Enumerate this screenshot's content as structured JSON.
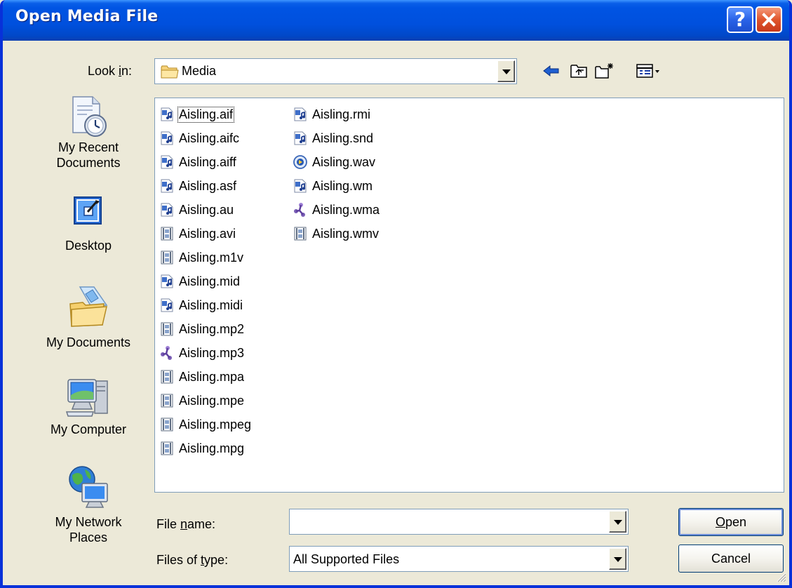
{
  "window": {
    "title": "Open Media File"
  },
  "look_in": {
    "label_pre": "Look ",
    "label_key": "i",
    "label_post": "n:",
    "value": "Media"
  },
  "places": [
    {
      "line1": "My Recent",
      "line2": "Documents",
      "icon": "recent-documents-icon"
    },
    {
      "line1": "Desktop",
      "line2": "",
      "icon": "desktop-icon"
    },
    {
      "line1": "My Documents",
      "line2": "",
      "icon": "my-documents-icon"
    },
    {
      "line1": "My Computer",
      "line2": "",
      "icon": "my-computer-icon"
    },
    {
      "line1": "My Network",
      "line2": "Places",
      "icon": "network-places-icon"
    }
  ],
  "files_col1": [
    {
      "name": "Aisling.aif",
      "icon": "audio"
    },
    {
      "name": "Aisling.aifc",
      "icon": "audio"
    },
    {
      "name": "Aisling.aiff",
      "icon": "audio"
    },
    {
      "name": "Aisling.asf",
      "icon": "audio"
    },
    {
      "name": "Aisling.au",
      "icon": "audio"
    },
    {
      "name": "Aisling.avi",
      "icon": "video"
    },
    {
      "name": "Aisling.m1v",
      "icon": "video"
    },
    {
      "name": "Aisling.mid",
      "icon": "audio"
    },
    {
      "name": "Aisling.midi",
      "icon": "audio"
    },
    {
      "name": "Aisling.mp2",
      "icon": "video"
    },
    {
      "name": "Aisling.mp3",
      "icon": "wma"
    },
    {
      "name": "Aisling.mpa",
      "icon": "video"
    },
    {
      "name": "Aisling.mpe",
      "icon": "video"
    },
    {
      "name": "Aisling.mpeg",
      "icon": "video"
    },
    {
      "name": "Aisling.mpg",
      "icon": "video"
    }
  ],
  "files_col2": [
    {
      "name": "Aisling.rmi",
      "icon": "audio"
    },
    {
      "name": "Aisling.snd",
      "icon": "audio"
    },
    {
      "name": "Aisling.wav",
      "icon": "wav"
    },
    {
      "name": "Aisling.wm",
      "icon": "audio"
    },
    {
      "name": "Aisling.wma",
      "icon": "wma"
    },
    {
      "name": "Aisling.wmv",
      "icon": "video"
    }
  ],
  "file_name": {
    "label_pre": "File ",
    "label_key": "n",
    "label_post": "ame:",
    "value": ""
  },
  "file_type": {
    "label_pre": "Files of ",
    "label_key": "t",
    "label_post": "ype:",
    "value": "All Supported Files"
  },
  "buttons": {
    "open_key": "O",
    "open_rest": "pen",
    "cancel": "Cancel"
  }
}
